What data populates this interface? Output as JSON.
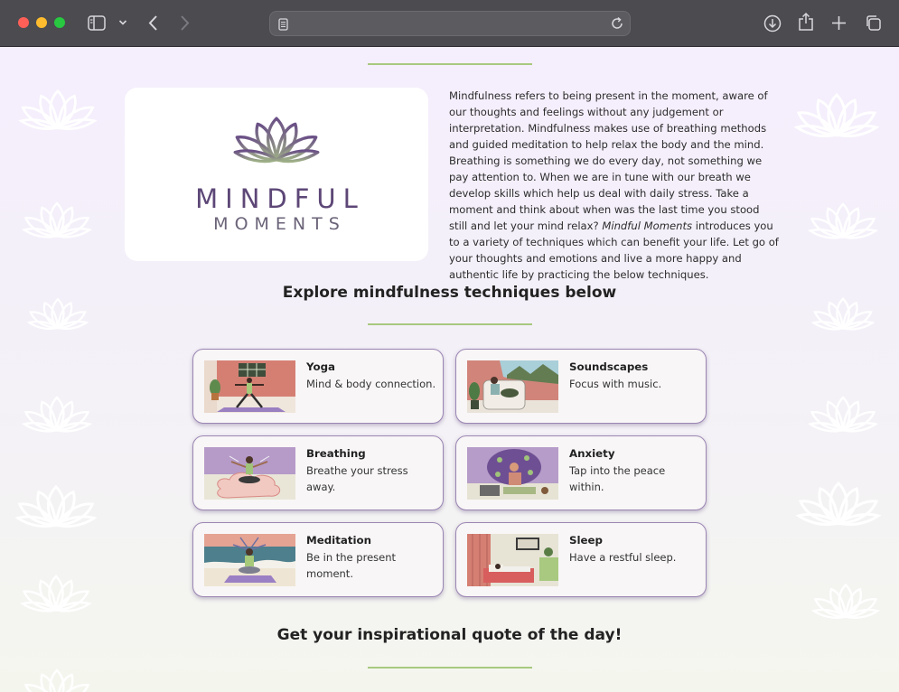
{
  "browser": {
    "address_text": "",
    "colors": {
      "chrome": "#4b4b50",
      "close": "#fe5f57",
      "minimize": "#febc2e",
      "zoom": "#28c840"
    }
  },
  "logo": {
    "line1": "MINDFUL",
    "line2": "MOMENTS"
  },
  "intro": {
    "text_before": "Mindfulness refers to being present in the moment, aware of our thoughts and feelings without any judgement or interpretation. Mindfulness makes use of breathing methods and guided meditation to help relax the body and the mind. Breathing is something we do every day, not something we pay attention to. When we are in tune with our breath we develop skills which help us deal with daily stress. Take a moment and think about when was the last time you stood still and let your mind relax? ",
    "emphasis": "Mindful Moments",
    "text_after": " introduces you to a variety of techniques which can benefit your life. Let go of your thoughts and emotions and live a more happy and authentic life by practicing the below techniques."
  },
  "explore_heading": "Explore mindfulness techniques below",
  "quote_heading": "Get your inspirational quote of the day!",
  "cards": [
    {
      "title": "Yoga",
      "desc": "Mind & body connection."
    },
    {
      "title": "Soundscapes",
      "desc": "Focus with music."
    },
    {
      "title": "Breathing",
      "desc": "Breathe your stress away."
    },
    {
      "title": "Anxiety",
      "desc": "Tap into the peace within."
    },
    {
      "title": "Meditation",
      "desc": "Be in the present moment."
    },
    {
      "title": "Sleep",
      "desc": "Have a restful sleep."
    }
  ],
  "theme": {
    "accent_green": "#a8c97f",
    "purple": "#5d4777",
    "card_border": "#9b86b4"
  }
}
